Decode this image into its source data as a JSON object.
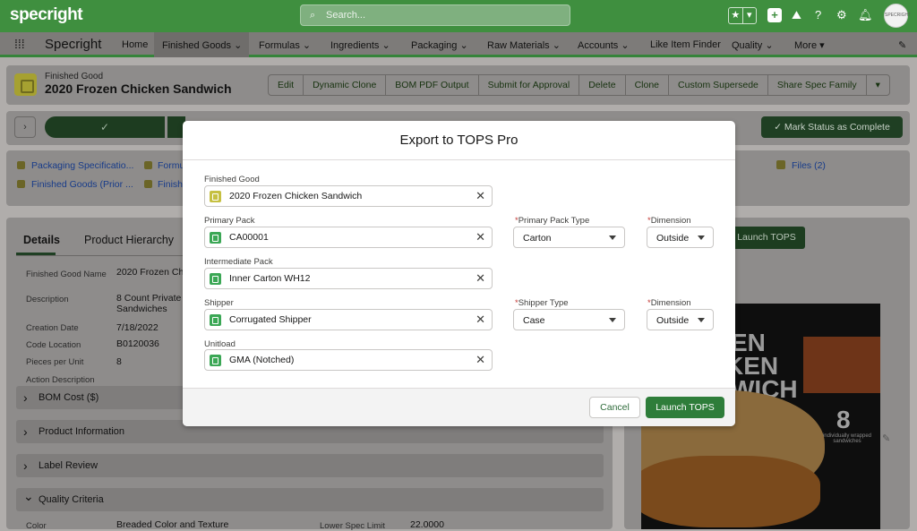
{
  "app": {
    "logo": "specright",
    "name": "Specright",
    "search_placeholder": "Search...",
    "avatar_text": "SPECRIGHT"
  },
  "nav": {
    "items": [
      "Home",
      "Finished Goods",
      "Formulas",
      "Ingredients",
      "Packaging",
      "Raw Materials",
      "Accounts",
      "Like Item Finder",
      "Quality",
      "More"
    ]
  },
  "record": {
    "type_label": "Finished Good",
    "title": "2020 Frozen Chicken Sandwich",
    "actions": [
      "Edit",
      "Dynamic Clone",
      "BOM PDF Output",
      "Submit for Approval",
      "Delete",
      "Clone",
      "Custom Supersede",
      "Share Spec Family"
    ],
    "mark_status": "Mark Status as Complete",
    "related": [
      "Packaging Specificatio...",
      "Finished Goods (Prior ...",
      "Formu",
      "Finish"
    ],
    "files": "Files (2)",
    "launch_tops_bg": "Launch TOPS"
  },
  "tabs": [
    "Details",
    "Product Hierarchy"
  ],
  "details": {
    "fields": [
      {
        "label": "Finished Good Name",
        "value": "2020 Frozen Ch"
      },
      {
        "label": "Description",
        "value": "8 Count Private Sandwiches"
      },
      {
        "label": "Creation Date",
        "value": "7/18/2022"
      },
      {
        "label": "Code Location",
        "value": "B0120036"
      },
      {
        "label": "Pieces per Unit",
        "value": "8"
      },
      {
        "label": "Action Description",
        "value": ""
      }
    ],
    "sections": [
      "BOM Cost ($)",
      "Product Information",
      "Label Review",
      "Quality Criteria"
    ],
    "qc_row": {
      "label": "Color",
      "value": "Breaded Color and Texture",
      "lsl_label": "Lower Spec Limit",
      "lsl_value": "22.0000"
    }
  },
  "product_image": {
    "line1": "EN",
    "line2": "KEN",
    "line3": "WICH",
    "count": "8",
    "count_caption": "individually wrapped sandwiches"
  },
  "modal": {
    "title": "Export to TOPS Pro",
    "finished_good": {
      "label": "Finished Good",
      "value": "2020 Frozen Chicken Sandwich"
    },
    "primary_pack": {
      "label": "Primary Pack",
      "value": "CA00001",
      "type_label": "Primary Pack Type",
      "type_value": "Carton",
      "dim_label": "Dimension",
      "dim_value": "Outside"
    },
    "intermediate_pack": {
      "label": "Intermediate Pack",
      "value": "Inner Carton WH12"
    },
    "shipper": {
      "label": "Shipper",
      "value": "Corrugated Shipper",
      "type_label": "Shipper Type",
      "type_value": "Case",
      "dim_label": "Dimension",
      "dim_value": "Outside"
    },
    "unitload": {
      "label": "Unitload",
      "value": "GMA (Notched)"
    },
    "cancel": "Cancel",
    "launch": "Launch TOPS"
  }
}
